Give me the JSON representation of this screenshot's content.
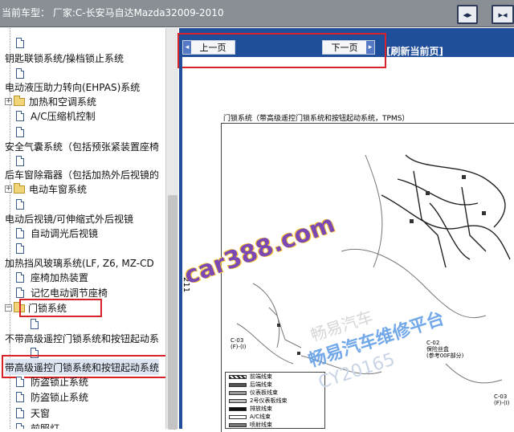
{
  "header": {
    "title": "当前车型： 厂家:C-长安马自达Mazda32009-2010"
  },
  "tree": {
    "items": [
      {
        "label": "",
        "kind": "page"
      },
      {
        "label": "钥匙联锁系统/操档锁止系统",
        "kind": "text"
      },
      {
        "label": "",
        "kind": "page"
      },
      {
        "label": "电动液压助力转向(EHPAS)系统",
        "kind": "text"
      },
      {
        "label": "加热和空调系统",
        "kind": "folder"
      },
      {
        "label": "A/C压缩机控制",
        "kind": "page"
      },
      {
        "label": "",
        "kind": "page"
      },
      {
        "label": "安全气囊系统（包括预张紧装置座椅",
        "kind": "text"
      },
      {
        "label": "",
        "kind": "page"
      },
      {
        "label": "后车窗除霜器（包括加热外后视镜的",
        "kind": "text"
      },
      {
        "label": "电动车窗系统",
        "kind": "folder"
      },
      {
        "label": "",
        "kind": "page"
      },
      {
        "label": "电动后视镜/可伸缩式外后视镜",
        "kind": "text"
      },
      {
        "label": "自动调光后视镜",
        "kind": "page"
      },
      {
        "label": "",
        "kind": "page"
      },
      {
        "label": "加热挡风玻璃系统(LF, Z6, MZ-CD",
        "kind": "text"
      },
      {
        "label": "座椅加热装置",
        "kind": "page"
      },
      {
        "label": "记忆电动调节座椅",
        "kind": "page"
      },
      {
        "label": "门锁系统",
        "kind": "folder-open"
      },
      {
        "label": "",
        "kind": "page"
      },
      {
        "label": "不带高级遥控门锁系统和按钮起动系",
        "kind": "text"
      },
      {
        "label": "",
        "kind": "page"
      },
      {
        "label": "带高级遥控门锁系统和按钮起动系统",
        "kind": "text-selected"
      },
      {
        "label": "防盗锁止系统",
        "kind": "page"
      },
      {
        "label": "防盗锁止系统",
        "kind": "page"
      },
      {
        "label": "天窗",
        "kind": "page"
      },
      {
        "label": "前照灯",
        "kind": "page"
      }
    ]
  },
  "toolbar": {
    "prev_label": "上一页",
    "next_label": "下一页",
    "refresh_label": "[刷新当前页]"
  },
  "document": {
    "page_number": "211",
    "diagram_title": "门锁系统（带高级遥控门锁系统和按钮起动系统，TPMS）",
    "connectors": [
      "C-03",
      "(F)-(I)",
      "C-02",
      "(F)-(I)",
      "C-03",
      "(F)-(I)"
    ],
    "note": "保险丝盒",
    "note2": "(参考00F部分)",
    "legend": [
      "前端线束",
      "后端线束",
      "仪表板线束",
      "2号仪表板线束",
      "排放线束",
      "A/C线束",
      "喷射线束"
    ],
    "watermarks": [
      "car388.com",
      "畅易汽车维修平台",
      "CY20165",
      "畅易汽车"
    ]
  },
  "colors": {
    "header_bg": "#8a8f96",
    "toolbar_bg": "#1f4f9a",
    "highlight": "#d9232b",
    "watermark_purple": "#7a49b4",
    "watermark_blue": "#5b9ae6"
  },
  "icons": {
    "header_button_1": "expand-toggle-icon",
    "header_button_2": "collapse-toggle-icon",
    "prev": "arrow-left-icon",
    "next": "arrow-right-icon",
    "tree_page": "page-icon",
    "tree_folder": "folder-icon"
  }
}
